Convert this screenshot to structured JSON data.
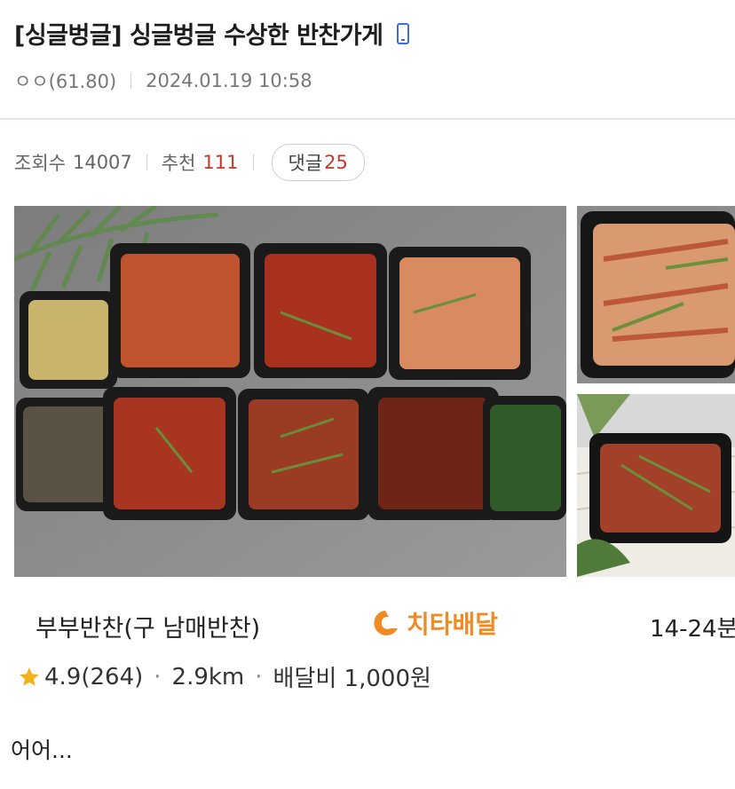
{
  "post": {
    "title": "[싱글벙글] 싱글벙글 수상한 반찬가게",
    "author": "ㅇㅇ(61.80)",
    "datetime": "2024.01.19 10:58",
    "views_label": "조회수",
    "views": "14007",
    "likes_label": "추천",
    "likes": "111",
    "comments_label": "댓글",
    "comments": "25",
    "body_text": "어어..."
  },
  "shop": {
    "name": "부부반찬(구 남매반찬)",
    "brand": "치타배달",
    "time_range": "14-24분",
    "rating": "4.9(264)",
    "distance": "2.9km",
    "delivery_fee": "배달비 1,000원"
  },
  "icons": {
    "mobile": "mobile-phone-icon",
    "star": "star-icon",
    "brand_logo": "cheetah-logo-icon"
  },
  "colors": {
    "accent_red": "#c0392b",
    "brand_orange": "#f08a24",
    "mobile_blue": "#3b6fd8",
    "star_yellow": "#f2b21c"
  }
}
